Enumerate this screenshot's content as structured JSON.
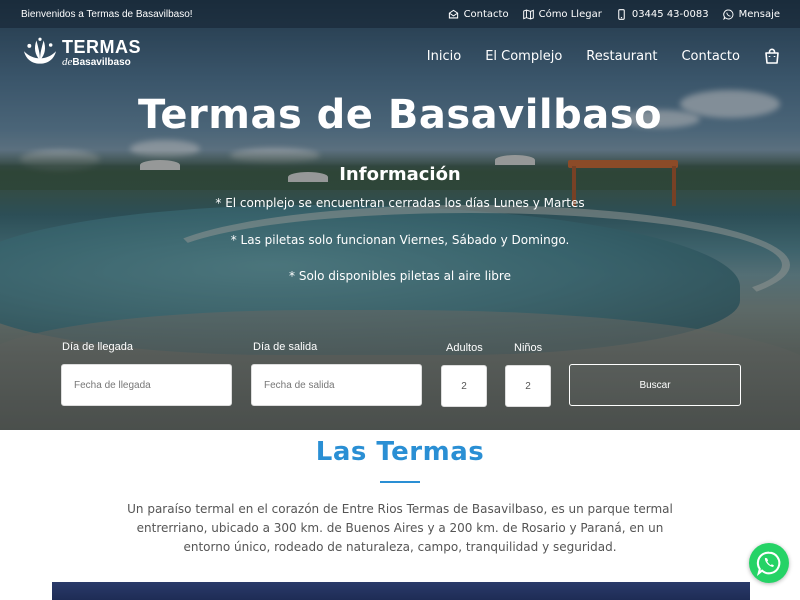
{
  "topbar": {
    "welcome": "Bienvenidos a Termas de Basavilbaso!",
    "links": [
      {
        "label": "Contacto",
        "icon": "envelope-icon"
      },
      {
        "label": "Cómo Llegar",
        "icon": "map-icon"
      },
      {
        "label": "03445 43-0083",
        "icon": "phone-icon"
      },
      {
        "label": "Mensaje",
        "icon": "whatsapp-icon"
      }
    ]
  },
  "logo": {
    "line1": "TERMAS",
    "line2_prefix": "de",
    "line2_name": "Basavilbaso"
  },
  "nav": {
    "items": [
      "Inicio",
      "El Complejo",
      "Restaurant",
      "Contacto"
    ],
    "cart_icon": "shopping-bag-icon"
  },
  "hero": {
    "title": "Termas de Basavilbaso",
    "info_title": "Información",
    "info_lines": [
      "* El complejo se encuentran cerradas los días Lunes y Martes",
      "* Las piletas solo funcionan Viernes, Sábado y Domingo.",
      "* Solo disponibles piletas al aire libre"
    ]
  },
  "booking": {
    "arrival_label": "Día de llegada",
    "arrival_placeholder": "Fecha de llegada",
    "departure_label": "Día de salida",
    "departure_placeholder": "Fecha de salida",
    "adults_label": "Adultos",
    "adults_value": "2",
    "children_label": "Niños",
    "children_value": "2",
    "search_label": "Buscar"
  },
  "content": {
    "title": "Las Termas",
    "paragraph": "Un paraíso termal en el corazón de Entre Rios Termas de Basavilbaso, es un parque termal entrerriano, ubicado a 300 km. de Buenos Aires y a 200 km. de Rosario y Paraná, en un entorno único, rodeado de naturaleza, campo, tranquilidad y seguridad."
  },
  "colors": {
    "accent": "#2a8fd4",
    "whatsapp": "#25d366"
  }
}
